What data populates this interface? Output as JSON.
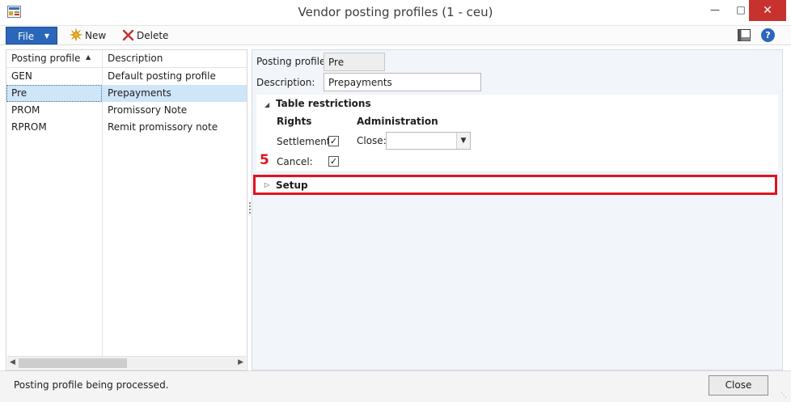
{
  "window": {
    "title": "Vendor posting profiles (1 - ceu)",
    "minimize_glyph": "—",
    "maximize_glyph": "□",
    "close_glyph": "✕"
  },
  "toolbar": {
    "file_label": "File",
    "new_label": "New",
    "delete_label": "Delete"
  },
  "grid": {
    "columns": [
      "Posting profile",
      "Description"
    ],
    "sort_glyph": "▲",
    "rows": [
      {
        "profile": "GEN",
        "description": "Default posting profile",
        "selected": false
      },
      {
        "profile": "Pre",
        "description": "Prepayments",
        "selected": true
      },
      {
        "profile": "PROM",
        "description": "Promissory Note",
        "selected": false
      },
      {
        "profile": "RPROM",
        "description": "Remit promissory note",
        "selected": false
      }
    ]
  },
  "detail": {
    "posting_profile_label": "Posting profile:",
    "posting_profile_value": "Pre",
    "description_label": "Description:",
    "description_value": "Prepayments",
    "table_restrictions": {
      "header": "Table restrictions",
      "rights_label": "Rights",
      "administration_label": "Administration",
      "settlement_label": "Settlement:",
      "settlement_checked": true,
      "cancel_label": "Cancel:",
      "cancel_checked": true,
      "close_label": "Close:",
      "close_value": ""
    },
    "setup": {
      "header": "Setup"
    }
  },
  "annotation": {
    "step_number": "5",
    "highlight_color": "#e0141e"
  },
  "status": {
    "text": "Posting profile being processed.",
    "close_button": "Close"
  },
  "colors": {
    "file_button": "#2a66b9",
    "selected_row": "#cfe5f8",
    "window_close": "#c7312e"
  }
}
